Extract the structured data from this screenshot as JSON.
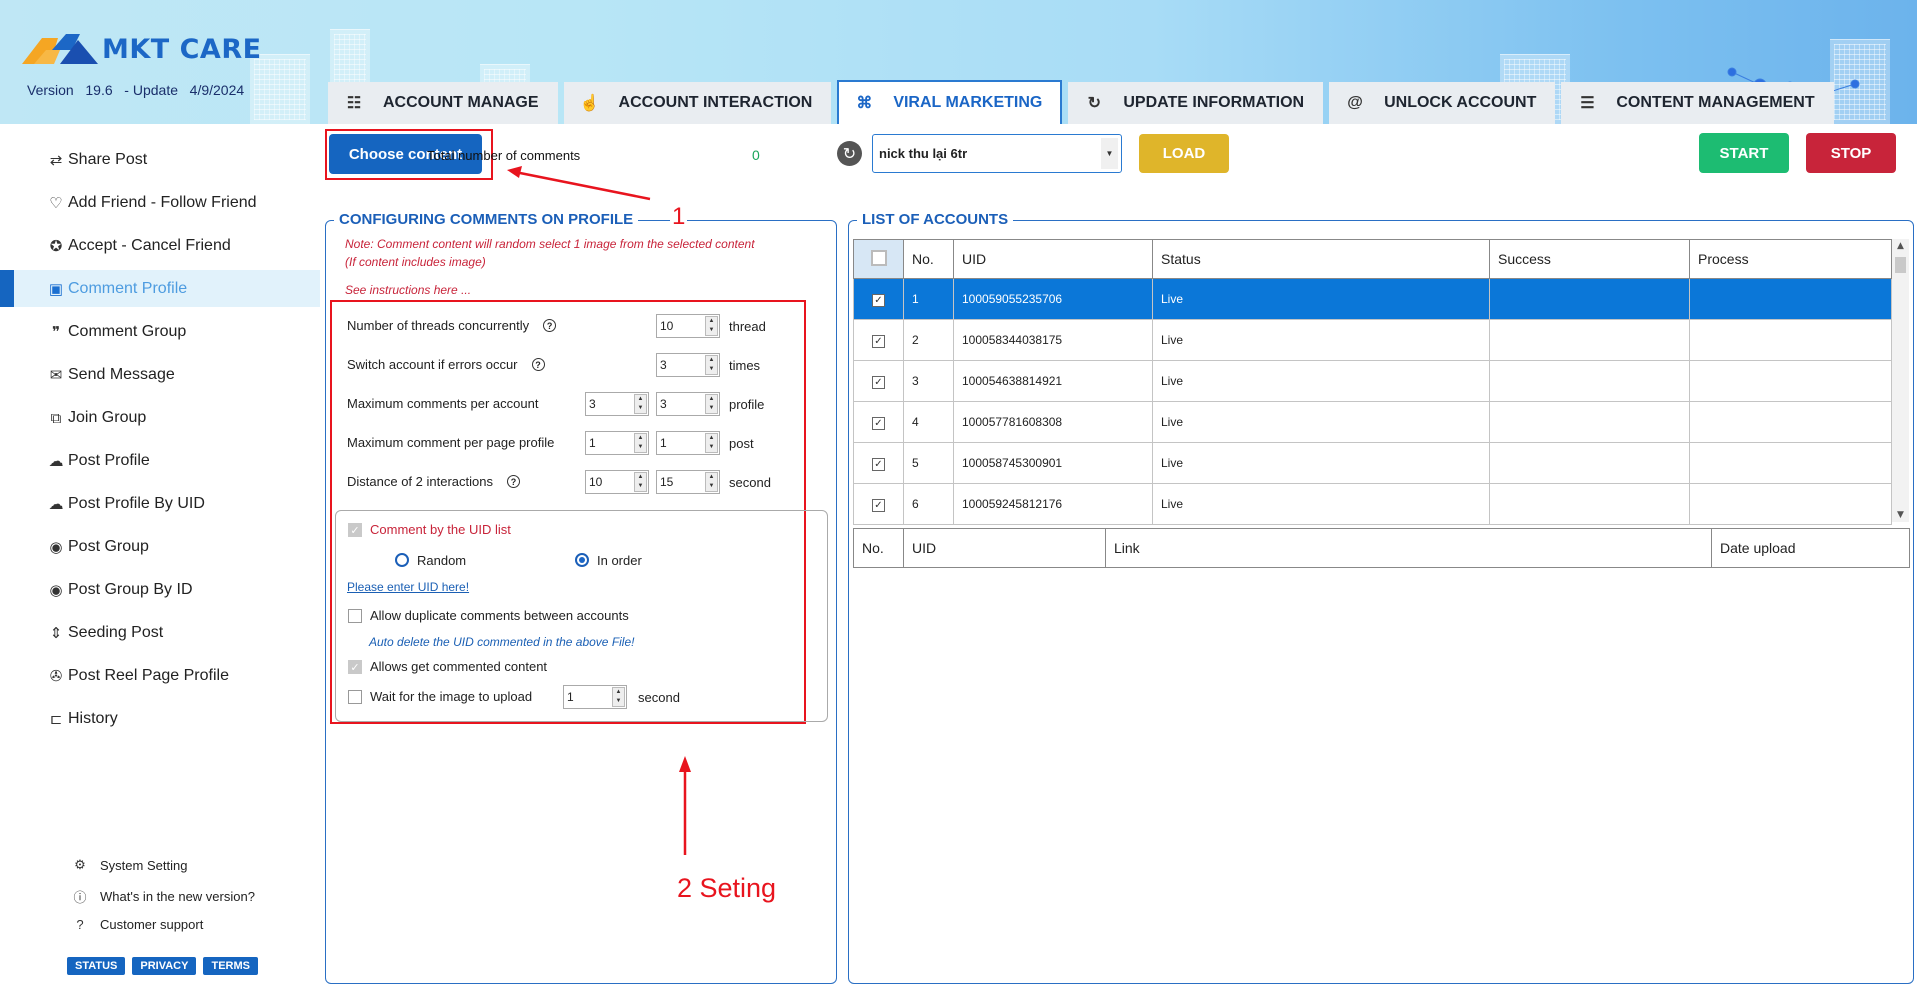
{
  "app": {
    "brand": "MKT CARE",
    "version_label": "Version",
    "version": "19.6",
    "update_label": "- Update",
    "update_date": "4/9/2024"
  },
  "tabs": [
    {
      "label": "ACCOUNT MANAGE",
      "icon": "list-search-icon",
      "active": false
    },
    {
      "label": "ACCOUNT INTERACTION",
      "icon": "hand-pointer-icon",
      "active": false
    },
    {
      "label": "VIRAL MARKETING",
      "icon": "network-nodes-icon",
      "active": true
    },
    {
      "label": "UPDATE INFORMATION",
      "icon": "refresh-check-icon",
      "active": false
    },
    {
      "label": "UNLOCK ACCOUNT",
      "icon": "fingerprint-icon",
      "active": false
    },
    {
      "label": "CONTENT MANAGEMENT",
      "icon": "document-icon",
      "active": false
    }
  ],
  "sidebar": {
    "items": [
      {
        "label": "Share Post",
        "icon": "share-arrows-icon"
      },
      {
        "label": "Add Friend - Follow Friend",
        "icon": "hearts-icon"
      },
      {
        "label": "Accept - Cancel Friend",
        "icon": "badge-check-icon"
      },
      {
        "label": "Comment Profile",
        "icon": "profile-card-icon",
        "active": true
      },
      {
        "label": "Comment Group",
        "icon": "quote-bubble-icon"
      },
      {
        "label": "Send Message",
        "icon": "mail-icon"
      },
      {
        "label": "Join Group",
        "icon": "group-join-icon"
      },
      {
        "label": "Post Profile",
        "icon": "cloud-upload-icon"
      },
      {
        "label": "Post Profile By UID",
        "icon": "cloud-upload-icon"
      },
      {
        "label": "Post Group",
        "icon": "eye-search-icon"
      },
      {
        "label": "Post Group By ID",
        "icon": "eye-search-icon"
      },
      {
        "label": "Seeding Post",
        "icon": "vertical-arrows-icon"
      },
      {
        "label": "Post Reel Page Profile",
        "icon": "film-reel-icon"
      },
      {
        "label": "History",
        "icon": "history-icon"
      }
    ],
    "footer_links": [
      {
        "label": "System Setting",
        "icon": "gear-icon"
      },
      {
        "label": "What's in the new version?",
        "icon": "info-icon"
      },
      {
        "label": "Customer support",
        "icon": "help-icon"
      }
    ],
    "footer_buttons": [
      "STATUS",
      "PRIVACY",
      "TERMS"
    ]
  },
  "toolbar": {
    "choose_content": "Choose content",
    "total_comments_label": "Total number of comments",
    "total_comments_value": "0",
    "account_folder": "nick thu lại 6tr",
    "load": "LOAD",
    "start": "START",
    "stop": "STOP"
  },
  "config": {
    "title": "CONFIGURING COMMENTS ON PROFILE",
    "note_line1": "Note: Comment content will random select 1 image from the selected content",
    "note_line2": "(If content includes image)",
    "instructions_link": "See instructions here ...",
    "rows": [
      {
        "label": "Number of threads concurrently",
        "help": true,
        "values": [
          "10"
        ],
        "unit": "thread"
      },
      {
        "label": "Switch account if errors occur",
        "help": true,
        "values": [
          "3"
        ],
        "unit": "times"
      },
      {
        "label": "Maximum comments per account",
        "help": false,
        "values": [
          "3",
          "3"
        ],
        "unit": "profile"
      },
      {
        "label": "Maximum comment per page profile",
        "help": false,
        "values": [
          "1",
          "1"
        ],
        "unit": "post"
      },
      {
        "label": "Distance of 2 interactions",
        "help": true,
        "values": [
          "10",
          "15"
        ],
        "unit": "second"
      }
    ],
    "uid_list": {
      "label": "Comment by the UID list",
      "checked": true,
      "order_options": [
        "Random",
        "In order"
      ],
      "selected_order": "In order",
      "enter_uid_link": "Please enter UID here!",
      "allow_duplicate_label": "Allow duplicate comments between accounts",
      "allow_duplicate_checked": false,
      "auto_delete_hint": "Auto delete the UID commented in the above File!",
      "get_commented_label": "Allows get commented content",
      "get_commented_checked": true,
      "wait_image_label": "Wait for the image to upload",
      "wait_image_checked": false,
      "wait_image_value": "1",
      "wait_image_unit": "second"
    }
  },
  "accounts": {
    "title": "LIST OF ACCOUNTS",
    "columns": [
      "No.",
      "UID",
      "Status",
      "Success",
      "Process"
    ],
    "rows": [
      {
        "no": "1",
        "uid": "100059055235706",
        "status": "Live",
        "success": "",
        "process": "",
        "checked": true,
        "selected": true
      },
      {
        "no": "2",
        "uid": "100058344038175",
        "status": "Live",
        "success": "",
        "process": "",
        "checked": true
      },
      {
        "no": "3",
        "uid": "100054638814921",
        "status": "Live",
        "success": "",
        "process": "",
        "checked": true
      },
      {
        "no": "4",
        "uid": "100057781608308",
        "status": "Live",
        "success": "",
        "process": "",
        "checked": true
      },
      {
        "no": "5",
        "uid": "100058745300901",
        "status": "Live",
        "success": "",
        "process": "",
        "checked": true
      },
      {
        "no": "6",
        "uid": "100059245812176",
        "status": "Live",
        "success": "",
        "process": "",
        "checked": true
      }
    ],
    "upload_columns": [
      "No.",
      "UID",
      "Link",
      "Date upload"
    ]
  },
  "annotations": {
    "step1": "1",
    "step2": "2 Seting",
    "color": "#e8141e"
  },
  "colors": {
    "primary": "#1565c0",
    "start": "#1dbc72",
    "stop": "#c8243a",
    "load": "#dfb52a",
    "selected_row": "#0b77d8"
  }
}
